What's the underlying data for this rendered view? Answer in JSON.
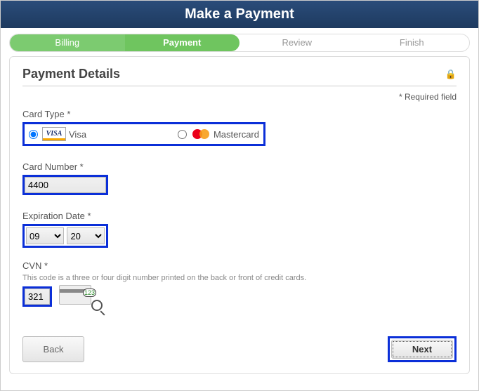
{
  "header": {
    "title": "Make a Payment"
  },
  "progress": {
    "billing": "Billing",
    "payment": "Payment",
    "review": "Review",
    "finish": "Finish"
  },
  "details": {
    "title": "Payment Details",
    "required_note": "* Required field",
    "card_type_label": "Card Type *",
    "visa_label": "Visa",
    "mc_label": "Mastercard",
    "card_type_selected": "visa",
    "card_number_label": "Card Number *",
    "card_number_value": "4400",
    "exp_label": "Expiration Date *",
    "exp_month": "09",
    "exp_year": "20",
    "cvn_label": "CVN *",
    "cvn_help": "This code is a three or four digit number printed on the back or front of credit cards.",
    "cvn_value": "321",
    "cvn_icon_code": "123"
  },
  "buttons": {
    "back": "Back",
    "next": "Next"
  }
}
